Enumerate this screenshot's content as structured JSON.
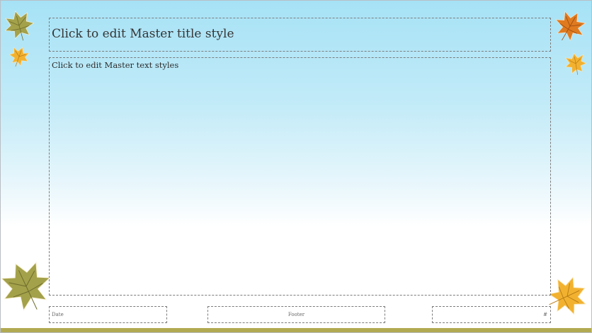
{
  "slide": {
    "title_placeholder": "Click to edit Master title style",
    "body_placeholder": "Click to edit Master text styles",
    "date_placeholder": "Date",
    "footer_placeholder": "Footer",
    "slide_number_placeholder": "#"
  },
  "colors": {
    "background_top": "#a6e2f6",
    "background_bottom": "#ffffff",
    "bottom_bar": "#b2aa52",
    "leaf_green": "#a3a14a",
    "leaf_orange": "#df7a1f",
    "leaf_yellow": "#f2b230"
  },
  "icons": [
    "green-leaf-icon",
    "orange-leaf-icon",
    "yellow-leaf-icon"
  ]
}
